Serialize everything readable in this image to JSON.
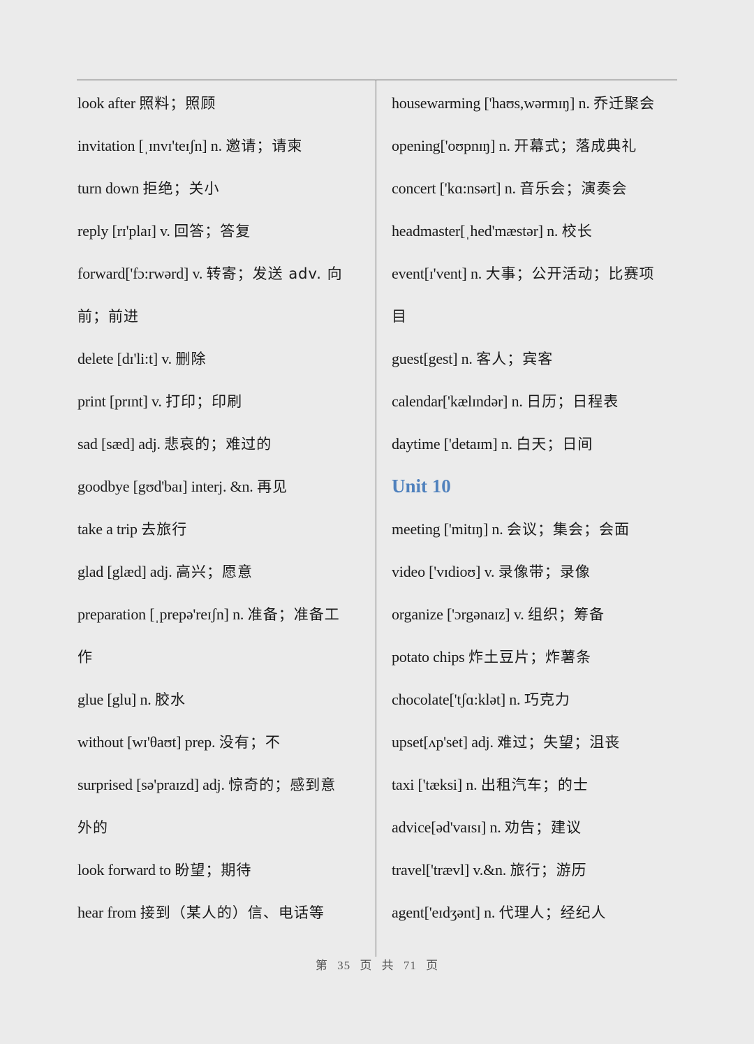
{
  "left_column": [
    {
      "type": "entry",
      "en": "look after",
      "cn": "照料；照顾"
    },
    {
      "type": "entry",
      "en": "invitation [ˌɪnvɪ'teɪʃn]   n.",
      "cn": "邀请；请柬"
    },
    {
      "type": "entry",
      "en": "turn down",
      "cn": "拒绝；关小"
    },
    {
      "type": "entry",
      "en": "reply [rɪ'plaɪ] v.",
      "cn": "回答；答复"
    },
    {
      "type": "entry",
      "en": "forward['fɔ:rwərd] v.",
      "cn": "转寄；发送  adv.  向"
    },
    {
      "type": "wrap",
      "en": "",
      "cn": "前；前进"
    },
    {
      "type": "entry",
      "en": "delete [dɪ'li:t] v.",
      "cn": "删除"
    },
    {
      "type": "entry",
      "en": "print [prɪnt] v.",
      "cn": "打印；印刷"
    },
    {
      "type": "entry",
      "en": "sad [sæd] adj.",
      "cn": "悲哀的；难过的"
    },
    {
      "type": "entry",
      "en": "goodbye [gʊd'baɪ] interj. &n.",
      "cn": "再见"
    },
    {
      "type": "entry",
      "en": "take a trip",
      "cn": "去旅行"
    },
    {
      "type": "entry",
      "en": "glad [glæd] adj.",
      "cn": "高兴；愿意"
    },
    {
      "type": "entry",
      "en": "preparation [ˌprepə'reɪʃn] n.",
      "cn": "准备；准备工"
    },
    {
      "type": "wrap",
      "en": "",
      "cn": "作"
    },
    {
      "type": "entry",
      "en": "glue [glu] n.",
      "cn": "胶水"
    },
    {
      "type": "entry",
      "en": "without [wɪ'θaʊt] prep.",
      "cn": "没有；不"
    },
    {
      "type": "entry",
      "en": "surprised [sə'praɪzd] adj.",
      "cn": "惊奇的；感到意"
    },
    {
      "type": "wrap",
      "en": "",
      "cn": "外的"
    },
    {
      "type": "entry",
      "en": "look forward to",
      "cn": "盼望；期待"
    },
    {
      "type": "entry",
      "en": "hear from",
      "cn": "接到（某人的）信、电话等"
    }
  ],
  "right_column": [
    {
      "type": "entry",
      "en": "housewarming ['haʊs,wərmɪŋ] n.",
      "cn": "乔迁聚会"
    },
    {
      "type": "entry",
      "en": "opening['oʊpnɪŋ] n.",
      "cn": "开幕式；落成典礼"
    },
    {
      "type": "entry",
      "en": "concert ['kɑ:nsərt] n.",
      "cn": "音乐会；演奏会"
    },
    {
      "type": "entry",
      "en": "headmaster[ˌhed'mæstər] n.",
      "cn": "校长"
    },
    {
      "type": "entry",
      "en": "event[ɪ'vent] n.",
      "cn": "大事；公开活动；比赛项"
    },
    {
      "type": "wrap",
      "en": "",
      "cn": "目"
    },
    {
      "type": "entry",
      "en": "guest[gest] n.",
      "cn": "客人；宾客"
    },
    {
      "type": "entry",
      "en": "calendar['kælɪndər] n.",
      "cn": "日历；日程表"
    },
    {
      "type": "entry",
      "en": "daytime ['detaɪm]    n.",
      "cn": "白天；日间"
    },
    {
      "type": "heading",
      "en": "Unit 10",
      "cn": ""
    },
    {
      "type": "entry",
      "en": "meeting ['mitɪŋ] n.",
      "cn": "会议；集会；会面"
    },
    {
      "type": "entry",
      "en": "video ['vɪdioʊ] v.",
      "cn": "录像带；录像"
    },
    {
      "type": "entry",
      "en": "organize ['ɔrgənaɪz] v.",
      "cn": "组织；筹备"
    },
    {
      "type": "entry",
      "en": "potato chips",
      "cn": "炸土豆片；炸薯条"
    },
    {
      "type": "entry",
      "en": "chocolate['tʃɑ:klət] n.",
      "cn": "巧克力"
    },
    {
      "type": "entry",
      "en": "upset[ʌp'set] adj.",
      "cn": "难过；失望；沮丧"
    },
    {
      "type": "entry",
      "en": "taxi ['tæksi] n.",
      "cn": "出租汽车；的士"
    },
    {
      "type": "entry",
      "en": "advice[əd'vaɪsɪ] n.",
      "cn": "劝告；建议"
    },
    {
      "type": "entry",
      "en": "travel['trævl] v.&n.",
      "cn": "旅行；游历"
    },
    {
      "type": "entry",
      "en": "agent['eɪdʒənt] n.",
      "cn": "代理人；经纪人"
    }
  ],
  "footer": {
    "prefix": "第",
    "current_page": "35",
    "page_word": "页",
    "total_word": "共",
    "total_pages": "71",
    "suffix": "页"
  },
  "colors": {
    "heading": "#4f81bd",
    "background": "#ebebeb",
    "text": "#1a1a1a"
  }
}
